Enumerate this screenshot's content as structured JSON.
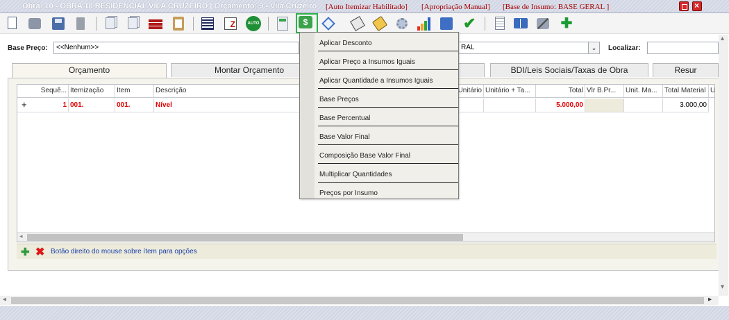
{
  "titlebar": {
    "title": "Obra: 10 - OBRA 10 RESIDENCIAL VILA CRUZEIRO | Orçamento: 9 - Vila Cruzeiro",
    "tags": [
      "[Auto Itemizar Habilitado]",
      "[Apropriação Manual]",
      "[Base de Insumo: BASE GERAL ]"
    ],
    "colors": {
      "bar": "#d1d6e4",
      "tag_text": "#a50000"
    }
  },
  "toolbar": {
    "icons": [
      "new-document-icon",
      "print-icon",
      "save-icon",
      "trash-icon",
      "copy-pages-icon",
      "paste-icon",
      "bricks-icon",
      "clipboard-icon",
      "list-icon",
      "list-z-icon",
      "auto-icon",
      "calculator-icon",
      "money-icon",
      "diamond-icon",
      "tag-icon",
      "pen-icon",
      "cog-icon",
      "bar-chart-icon",
      "export-icon",
      "check-icon",
      "notes-icon",
      "book-icon",
      "tools-icon",
      "add-icon"
    ],
    "auto_label": "AUTO",
    "money_glyph": "$",
    "check_glyph": "✔",
    "add_glyph": "✚",
    "selected_icon": "money-icon",
    "selected_outline": "#2db24a"
  },
  "base_preco": {
    "label": "Base Preço:",
    "value": "<<Nenhum>>",
    "second_value": "RAL",
    "localizar_label": "Localizar:",
    "localizar_value": ""
  },
  "tabs": [
    {
      "label": "Orçamento",
      "active": true
    },
    {
      "label": "Montar Orçamento",
      "active": false
    },
    {
      "label": "",
      "active": false
    },
    {
      "label": "BDI/Leis Sociais/Taxas de Obra",
      "active": false
    },
    {
      "label": "Resur",
      "active": false
    }
  ],
  "grid": {
    "columns": [
      "Sequê...",
      "Itemização",
      "Item",
      "Descrição",
      "Unitário",
      "Unitário + Ta...",
      "Total",
      "Vlr B.Pr...",
      "Unit. Ma...",
      "Total Material",
      "U"
    ],
    "rows": [
      {
        "expander": "+",
        "seq": "1",
        "itemizacao": "001.",
        "item": "001.",
        "descricao": "Nível",
        "unitario": "",
        "unitario_ta": "",
        "total": "5.000,00",
        "vlr_bpr": "",
        "unit_ma": "",
        "total_material": "3.000,00"
      }
    ]
  },
  "statusbar": {
    "add_glyph": "✚",
    "remove_glyph": "✖",
    "hint": "Botão direito do mouse sobre ítem para opções"
  },
  "menu": {
    "items": [
      "Aplicar Desconto",
      "Aplicar Preço a Insumos Iguais",
      "Aplicar Quantidade a Insumos Iguais",
      "Base Preços",
      "Base Percentual",
      "Base Valor Final",
      "Composição Base Valor Final",
      "Multiplicar Quantidades",
      "Preços por Insumo"
    ]
  },
  "scroll_glyphs": {
    "left": "◂",
    "right": "▸",
    "up": "▴",
    "down": "▾",
    "dropdown": "⌄"
  }
}
